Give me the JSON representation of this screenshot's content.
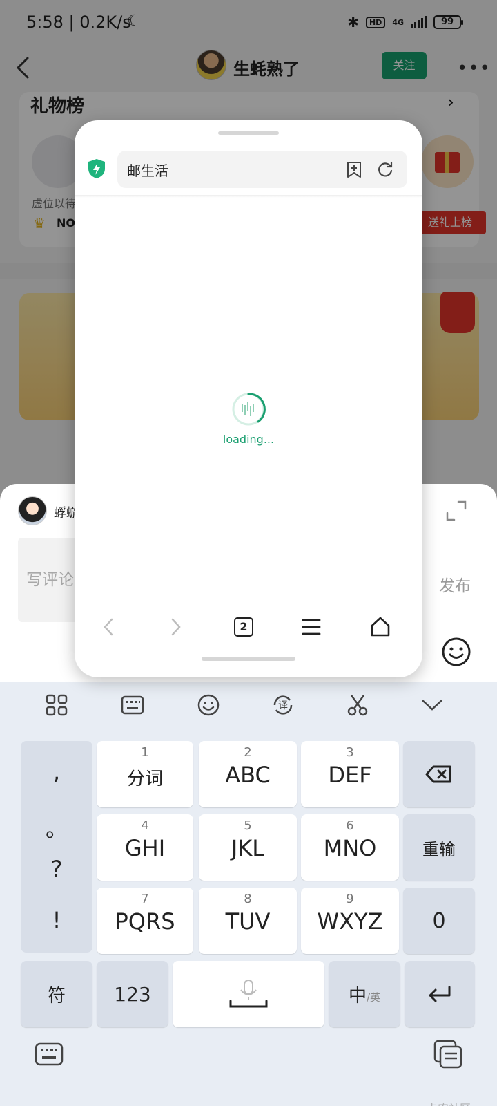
{
  "status_bar": {
    "time_speed": "5:58 | 0.2K/s",
    "network": "4G",
    "hd": "HD",
    "battery": "99"
  },
  "background_app": {
    "profile_name": "生蚝熟了",
    "follow_label": "关注",
    "gift_list_title": "礼物榜",
    "vacant_label": "虚位以待",
    "rank_label": "NO",
    "gift_rank_button": "送礼上榜"
  },
  "mini_browser": {
    "address_text": "邮生活",
    "loading_text": "loading...",
    "tab_count": "2"
  },
  "comment": {
    "user_name": "蜉蝣",
    "placeholder": "写评论",
    "publish_label": "发布"
  },
  "keyboard": {
    "punctuation": [
      ",",
      "。",
      "?",
      "!"
    ],
    "keys": [
      {
        "num": "1",
        "label": "分词"
      },
      {
        "num": "2",
        "label": "ABC"
      },
      {
        "num": "3",
        "label": "DEF"
      },
      {
        "num": "4",
        "label": "GHI"
      },
      {
        "num": "5",
        "label": "JKL"
      },
      {
        "num": "6",
        "label": "MNO"
      },
      {
        "num": "7",
        "label": "PQRS"
      },
      {
        "num": "8",
        "label": "TUV"
      },
      {
        "num": "9",
        "label": "WXYZ"
      }
    ],
    "reenter_label": "重输",
    "zero_label": "0",
    "symbol_label": "符",
    "num_label": "123",
    "lang_main": "中",
    "lang_sub": "/英"
  },
  "watermark": "卡农社区",
  "colors": {
    "accent_green": "#18a06e",
    "loading_green": "#1a9f70",
    "gift_red": "#e2352a"
  }
}
